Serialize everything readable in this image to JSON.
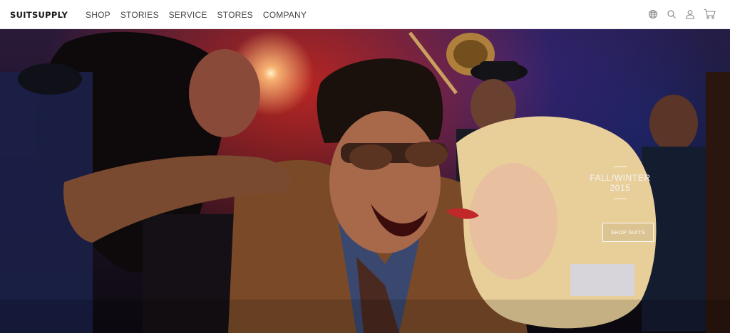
{
  "header": {
    "logo": "SUITSUPPLY",
    "nav": [
      {
        "label": "SHOP"
      },
      {
        "label": "STORIES"
      },
      {
        "label": "SERVICE"
      },
      {
        "label": "STORES"
      },
      {
        "label": "COMPANY"
      }
    ],
    "icons": [
      "globe-icon",
      "search-icon",
      "user-icon",
      "cart-icon"
    ]
  },
  "hero": {
    "collection_title": "FALL/WINTER 2015",
    "cta_label": "SHOP SUITS"
  },
  "colors": {
    "header_bg": "#ffffff",
    "nav_text": "#444444",
    "hero_text": "#ffffff"
  }
}
